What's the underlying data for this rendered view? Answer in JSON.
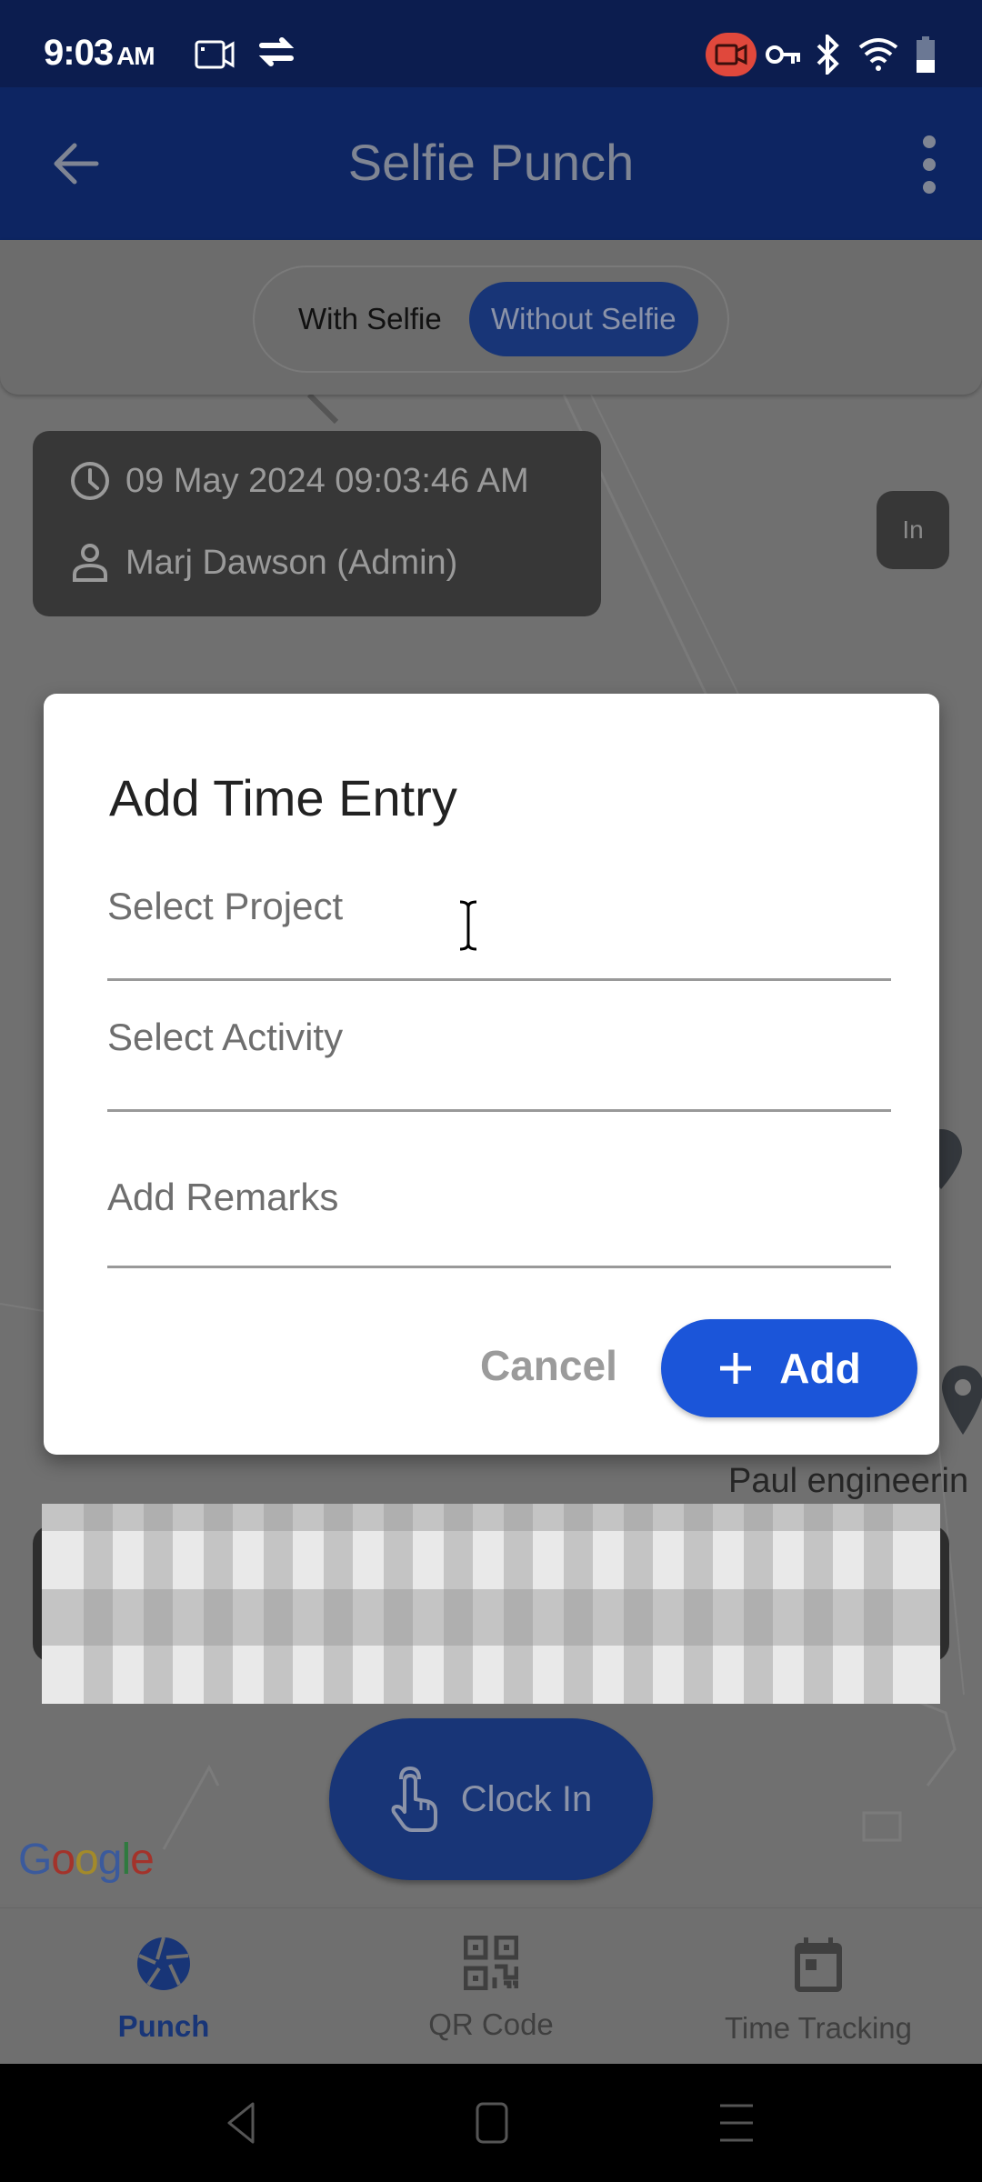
{
  "status_bar": {
    "time": "9:03",
    "ampm": "AM",
    "icons": [
      "screen-record-icon",
      "sync-icon",
      "recording-badge-icon",
      "vpn-key-icon",
      "bluetooth-icon",
      "wifi-icon",
      "battery-icon"
    ]
  },
  "app_bar": {
    "title": "Selfie Punch",
    "back_icon": "arrow-left-icon",
    "menu_icon": "more-vertical-icon"
  },
  "punch_mode_toggle": {
    "options": [
      "With Selfie",
      "Without Selfie"
    ],
    "selected": "Without Selfie"
  },
  "info_card": {
    "datetime": "09 May 2024 09:03:46 AM",
    "user": "Marj Dawson (Admin)"
  },
  "status_badge": "In",
  "map": {
    "place_label": "Paul engineerin",
    "attribution": "Google"
  },
  "clock_in_button": {
    "label": "Clock In"
  },
  "bottom_nav": {
    "items": [
      {
        "label": "Punch",
        "icon": "shutter-icon",
        "active": true
      },
      {
        "label": "QR Code",
        "icon": "qr-code-icon",
        "active": false
      },
      {
        "label": "Time Tracking",
        "icon": "calendar-icon",
        "active": false
      }
    ]
  },
  "dialog": {
    "title": "Add Time Entry",
    "fields": [
      {
        "placeholder": "Select Project",
        "value": ""
      },
      {
        "placeholder": "Select Activity",
        "value": ""
      },
      {
        "placeholder": "Add Remarks",
        "value": ""
      }
    ],
    "cancel_label": "Cancel",
    "add_label": "Add"
  },
  "colors": {
    "primary_blue": "#1b55d9",
    "app_bar": "#0d2562",
    "status_bar": "#0c1d4f"
  }
}
